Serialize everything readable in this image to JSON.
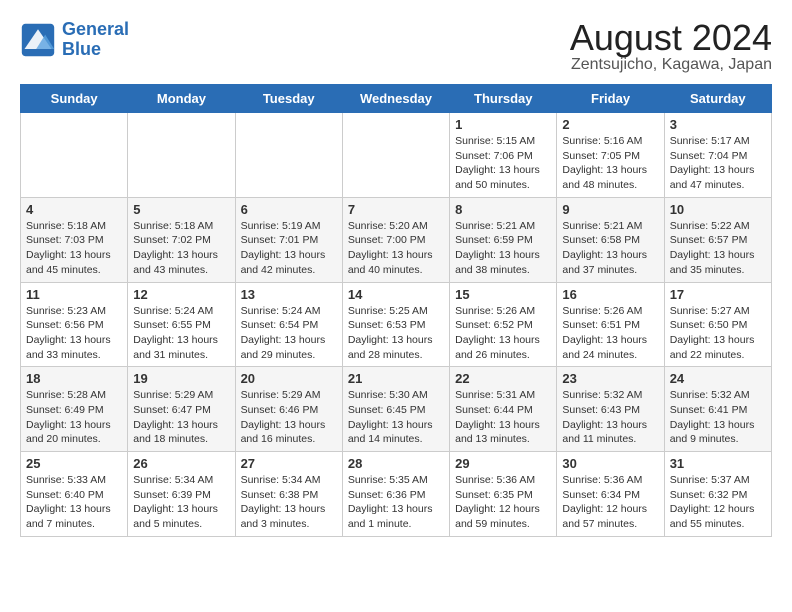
{
  "logo": {
    "name": "General",
    "name2": "Blue"
  },
  "title": "August 2024",
  "subtitle": "Zentsujicho, Kagawa, Japan",
  "days_of_week": [
    "Sunday",
    "Monday",
    "Tuesday",
    "Wednesday",
    "Thursday",
    "Friday",
    "Saturday"
  ],
  "weeks": [
    [
      {
        "day": "",
        "info": ""
      },
      {
        "day": "",
        "info": ""
      },
      {
        "day": "",
        "info": ""
      },
      {
        "day": "",
        "info": ""
      },
      {
        "day": "1",
        "info": "Sunrise: 5:15 AM\nSunset: 7:06 PM\nDaylight: 13 hours\nand 50 minutes."
      },
      {
        "day": "2",
        "info": "Sunrise: 5:16 AM\nSunset: 7:05 PM\nDaylight: 13 hours\nand 48 minutes."
      },
      {
        "day": "3",
        "info": "Sunrise: 5:17 AM\nSunset: 7:04 PM\nDaylight: 13 hours\nand 47 minutes."
      }
    ],
    [
      {
        "day": "4",
        "info": "Sunrise: 5:18 AM\nSunset: 7:03 PM\nDaylight: 13 hours\nand 45 minutes."
      },
      {
        "day": "5",
        "info": "Sunrise: 5:18 AM\nSunset: 7:02 PM\nDaylight: 13 hours\nand 43 minutes."
      },
      {
        "day": "6",
        "info": "Sunrise: 5:19 AM\nSunset: 7:01 PM\nDaylight: 13 hours\nand 42 minutes."
      },
      {
        "day": "7",
        "info": "Sunrise: 5:20 AM\nSunset: 7:00 PM\nDaylight: 13 hours\nand 40 minutes."
      },
      {
        "day": "8",
        "info": "Sunrise: 5:21 AM\nSunset: 6:59 PM\nDaylight: 13 hours\nand 38 minutes."
      },
      {
        "day": "9",
        "info": "Sunrise: 5:21 AM\nSunset: 6:58 PM\nDaylight: 13 hours\nand 37 minutes."
      },
      {
        "day": "10",
        "info": "Sunrise: 5:22 AM\nSunset: 6:57 PM\nDaylight: 13 hours\nand 35 minutes."
      }
    ],
    [
      {
        "day": "11",
        "info": "Sunrise: 5:23 AM\nSunset: 6:56 PM\nDaylight: 13 hours\nand 33 minutes."
      },
      {
        "day": "12",
        "info": "Sunrise: 5:24 AM\nSunset: 6:55 PM\nDaylight: 13 hours\nand 31 minutes."
      },
      {
        "day": "13",
        "info": "Sunrise: 5:24 AM\nSunset: 6:54 PM\nDaylight: 13 hours\nand 29 minutes."
      },
      {
        "day": "14",
        "info": "Sunrise: 5:25 AM\nSunset: 6:53 PM\nDaylight: 13 hours\nand 28 minutes."
      },
      {
        "day": "15",
        "info": "Sunrise: 5:26 AM\nSunset: 6:52 PM\nDaylight: 13 hours\nand 26 minutes."
      },
      {
        "day": "16",
        "info": "Sunrise: 5:26 AM\nSunset: 6:51 PM\nDaylight: 13 hours\nand 24 minutes."
      },
      {
        "day": "17",
        "info": "Sunrise: 5:27 AM\nSunset: 6:50 PM\nDaylight: 13 hours\nand 22 minutes."
      }
    ],
    [
      {
        "day": "18",
        "info": "Sunrise: 5:28 AM\nSunset: 6:49 PM\nDaylight: 13 hours\nand 20 minutes."
      },
      {
        "day": "19",
        "info": "Sunrise: 5:29 AM\nSunset: 6:47 PM\nDaylight: 13 hours\nand 18 minutes."
      },
      {
        "day": "20",
        "info": "Sunrise: 5:29 AM\nSunset: 6:46 PM\nDaylight: 13 hours\nand 16 minutes."
      },
      {
        "day": "21",
        "info": "Sunrise: 5:30 AM\nSunset: 6:45 PM\nDaylight: 13 hours\nand 14 minutes."
      },
      {
        "day": "22",
        "info": "Sunrise: 5:31 AM\nSunset: 6:44 PM\nDaylight: 13 hours\nand 13 minutes."
      },
      {
        "day": "23",
        "info": "Sunrise: 5:32 AM\nSunset: 6:43 PM\nDaylight: 13 hours\nand 11 minutes."
      },
      {
        "day": "24",
        "info": "Sunrise: 5:32 AM\nSunset: 6:41 PM\nDaylight: 13 hours\nand 9 minutes."
      }
    ],
    [
      {
        "day": "25",
        "info": "Sunrise: 5:33 AM\nSunset: 6:40 PM\nDaylight: 13 hours\nand 7 minutes."
      },
      {
        "day": "26",
        "info": "Sunrise: 5:34 AM\nSunset: 6:39 PM\nDaylight: 13 hours\nand 5 minutes."
      },
      {
        "day": "27",
        "info": "Sunrise: 5:34 AM\nSunset: 6:38 PM\nDaylight: 13 hours\nand 3 minutes."
      },
      {
        "day": "28",
        "info": "Sunrise: 5:35 AM\nSunset: 6:36 PM\nDaylight: 13 hours\nand 1 minute."
      },
      {
        "day": "29",
        "info": "Sunrise: 5:36 AM\nSunset: 6:35 PM\nDaylight: 12 hours\nand 59 minutes."
      },
      {
        "day": "30",
        "info": "Sunrise: 5:36 AM\nSunset: 6:34 PM\nDaylight: 12 hours\nand 57 minutes."
      },
      {
        "day": "31",
        "info": "Sunrise: 5:37 AM\nSunset: 6:32 PM\nDaylight: 12 hours\nand 55 minutes."
      }
    ]
  ]
}
